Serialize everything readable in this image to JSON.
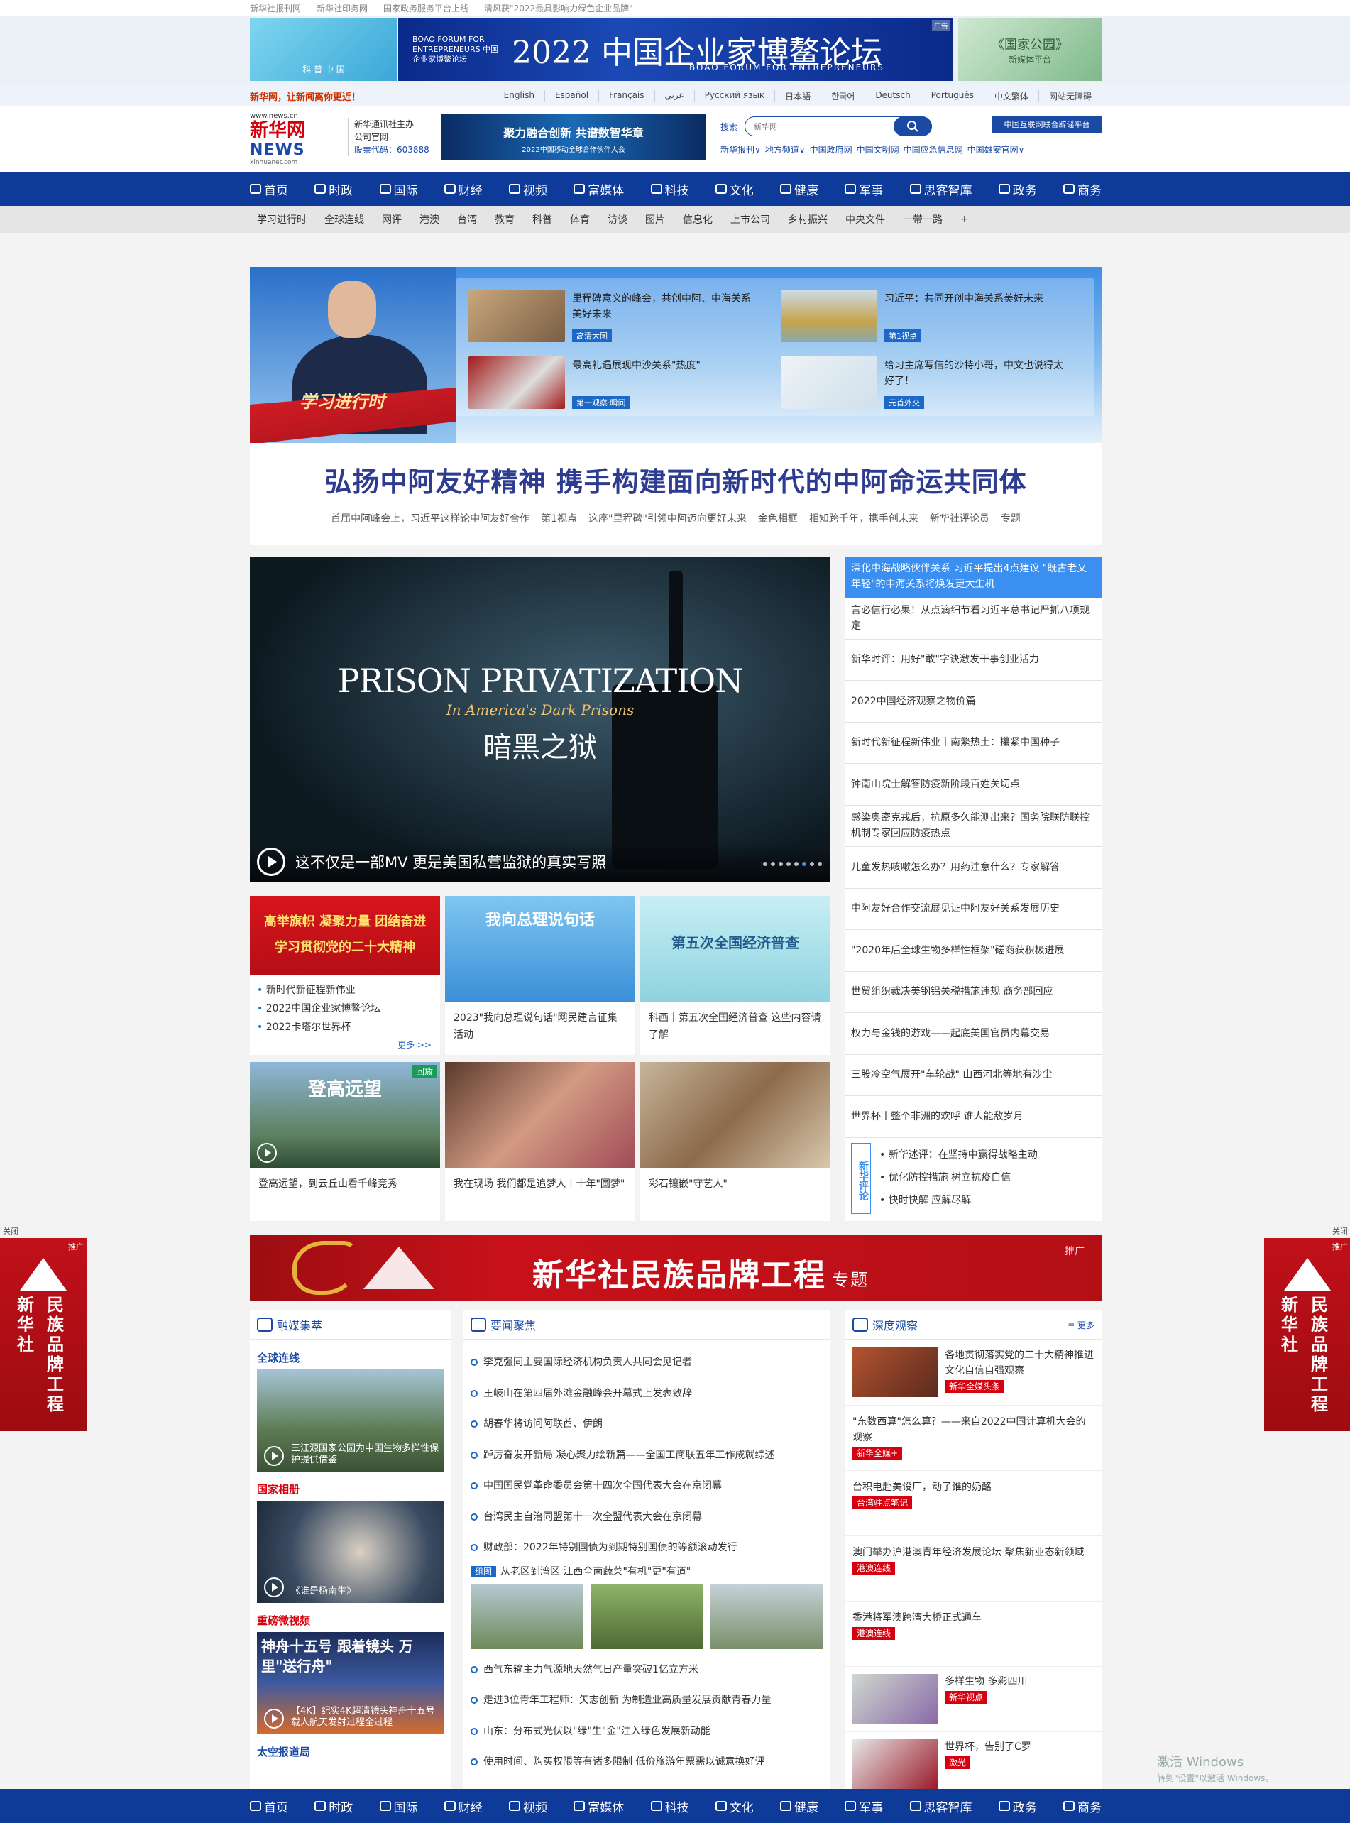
{
  "top_links": [
    "新华社报刊网",
    "新华社印务网",
    "国家政务服务平台上线",
    "清风获\"2022最具影响力绿色企业品牌\""
  ],
  "ads": {
    "ad1_text": "科 普 中 国",
    "ad2_small": "BOAO FORUM FOR ENTREPRENEURS 中国企业家博鳌论坛",
    "ad2_big": "2022 中国企业家博鳌论坛",
    "ad2_sub": "BOAO FORUM FOR ENTREPRENEURS",
    "ad2_tag": "广告",
    "ad3_title": "《国家公园》",
    "ad3_sub": "新媒体平台"
  },
  "lang_bar": {
    "slogan": "新华网，让新闻离你更近！",
    "languages": [
      "English",
      "Español",
      "Français",
      "عربي",
      "Русский язык",
      "日本語",
      "한국어",
      "Deutsch",
      "Português",
      "中文繁体",
      "网站无障碍"
    ]
  },
  "header": {
    "logo_url": "www.news.cn",
    "logo_cn": "新华网",
    "logo_en": "NEWS",
    "logo_site": "xinhuanet.com",
    "info_line1": "新华通讯社主办",
    "info_line2": "公司官网",
    "info_line3": "股票代码：603888",
    "banner_title": "聚力融合创新 共谱数智华章",
    "banner_sub": "2022中国移动全球合作伙伴大会",
    "search_label": "搜索",
    "search_placeholder": "新华网",
    "sublinks": [
      "新华报刊∨",
      "地方频道∨",
      "中国政府网",
      "中国文明网",
      "中国应急信息网",
      "中国雄安官网∨"
    ],
    "right_button": "中国互联网联合辟谣平台"
  },
  "nav": [
    "首页",
    "时政",
    "国际",
    "财经",
    "视频",
    "富媒体",
    "科技",
    "文化",
    "健康",
    "军事",
    "思客智库",
    "政务",
    "商务"
  ],
  "subnav": [
    "学习进行时",
    "全球连线",
    "网评",
    "港澳",
    "台湾",
    "教育",
    "科普",
    "体育",
    "访谈",
    "图片",
    "信息化",
    "上市公司",
    "乡村振兴",
    "中央文件",
    "一带一路",
    "+"
  ],
  "study": {
    "banner_text": "学习进行时",
    "items": [
      {
        "title": "里程碑意义的峰会，共创中阿、中海关系美好未来",
        "tag": "高清大图"
      },
      {
        "title": "习近平：共同开创中海关系美好未来",
        "tag": "第1视点"
      },
      {
        "title": "最高礼遇展现中沙关系\"热度\"",
        "tag": "第一观察·瞬间"
      },
      {
        "title": "给习主席写信的沙特小哥，中文也说得太好了！",
        "tag": "元首外交"
      }
    ]
  },
  "headline": {
    "title": "弘扬中阿友好精神 携手构建面向新时代的中阿命运共同体",
    "links": [
      "首届中阿峰会上，习近平这样论中阿友好合作",
      "第1视点",
      "这座\"里程碑\"引领中阿迈向更好未来",
      "金色相框",
      "相知跨千年，携手创未来",
      "新华社评论员",
      "专题"
    ]
  },
  "slider": {
    "en_title": "PRISON PRIVATIZATION",
    "en_sub": "In America's Dark Prisons",
    "zh_title": "暗黑之狱",
    "caption": "这不仅是一部MV 更是美国私营监狱的真实写照",
    "active_dot": 5,
    "dot_count": 8
  },
  "right_list": {
    "featured": "深化中海战略伙伴关系 习近平提出4点建议 \"既古老又年轻\"的中海关系将焕发更大生机",
    "rows": [
      "言必信行必果！从点滴细节看习近平总书记严抓八项规定",
      "新华时评：用好\"敢\"字诀激发干事创业活力",
      "2022中国经济观察之物价篇",
      "新时代新征程新伟业丨南繁热土：攥紧中国种子",
      "钟南山院士解答防疫新阶段百姓关切点",
      "感染奥密克戎后，抗原多久能测出来？国务院联防联控机制专家回应防疫热点",
      "儿童发热咳嗽怎么办？用药注意什么？专家解答",
      "中阿友好合作交流展见证中阿友好关系发展历史",
      "\"2020年后全球生物多样性框架\"磋商获积极进展",
      "世贸组织裁决美钢铝关税措施违规 商务部回应",
      "权力与金钱的游戏——起底美国官员内幕交易",
      "三股冷空气展开\"车轮战\" 山西河北等地有沙尘",
      "世界杯丨整个非洲的欢呼 谁人能敌岁月"
    ],
    "comment_label": "新华评论",
    "comments": [
      "新华述评：在坚持中赢得战略主动",
      "优化防控措施 树立抗疫自信",
      "快时快解 应解尽解"
    ]
  },
  "tiles": {
    "t1_banner1": "高举旗帜 凝聚力量 团结奋进",
    "t1_banner2": "学习贯彻党的二十大精神",
    "t1_items": [
      "新时代新征程新伟业",
      "2022中国企业家博鳌论坛",
      "2022卡塔尔世界杯"
    ],
    "t1_more": "更多 >>",
    "t2_img": "我向总理说句话",
    "t2_cap": "2023\"我向总理说句话\"网民建言征集活动",
    "t3_img": "第五次全国经济普查",
    "t3_cap": "科画丨第五次全国经济普查 这些内容请了解",
    "t4_img": "登高远望",
    "t4_badge": "回放",
    "t4_cap": "登高远望，到云丘山看千峰竞秀",
    "t5_cap": "我在现场 我们都是追梦人丨十年\"圆梦\"",
    "t6_cap": "彩石镶嵌\"守艺人\""
  },
  "brand_banner": {
    "title": "新华社民族品牌工程",
    "suffix": "专题",
    "tag": "推广"
  },
  "float_ad": {
    "close": "关闭",
    "tag": "推广",
    "text": [
      "民族品牌工程",
      "新华社"
    ]
  },
  "col1": {
    "title": "融媒集萃",
    "sec1": "全球连线",
    "img1_cap": "三江源国家公园为中国生物多样性保护提供借鉴",
    "sec2": "国家相册",
    "img2_cap": "《谁是杨南生》",
    "sec3": "重磅微视频",
    "img3_title": "神舟十五号 跟着镜头 万里\"送行舟\"",
    "img3_cap": "【4K】纪实4K超清镜头神舟十五号载人航天发射过程全过程",
    "sec4": "太空报道局"
  },
  "col2": {
    "title": "要闻聚焦",
    "items_top": [
      "李克强同主要国际经济机构负责人共同会见记者",
      "王岐山在第四届外滩金融峰会开幕式上发表致辞",
      "胡春华将访问阿联酋、伊朗",
      "踔厉奋发开新局 凝心聚力绘新篇——全国工商联五年工作成就综述",
      "中国国民党革命委员会第十四次全国代表大会在京闭幕",
      "台湾民主自治同盟第十一次全盟代表大会在京闭幕",
      "财政部：2022年特别国债为到期特别国债的等额滚动发行"
    ],
    "photo_tag": "组图",
    "photo_title": "从老区到湾区 江西全南蔬菜\"有机\"更\"有道\"",
    "items_bottom": [
      "西气东输主力气源地天然气日产量突破1亿立方米",
      "走进3位青年工程师：矢志创新 为制造业高质量发展贡献青春力量",
      "山东：分布式光伏以\"绿\"生\"金\"注入绿色发展新动能",
      "使用时间、购买权限等有诸多限制 低价旅游年票需以诚意换好评"
    ]
  },
  "col3": {
    "title": "深度观察",
    "more": "更多",
    "items": [
      {
        "title": "各地贯彻落实党的二十大精神推进文化自信自强观察",
        "tag": "新华全媒头条"
      },
      {
        "title": "\"东数西算\"怎么算？——来自2022中国计算机大会的观察",
        "tag": "新华全媒+"
      },
      {
        "title": "台积电赴美设厂，动了谁的奶酪",
        "tag": "台湾驻点笔记"
      },
      {
        "title": "澳门举办沪港澳青年经济发展论坛 聚焦新业态新领域",
        "tag": "港澳连线"
      },
      {
        "title": "香港将军澳跨湾大桥正式通车",
        "tag": "港澳连线"
      },
      {
        "title": "多样生物 多彩四川",
        "tag": "新华视点"
      },
      {
        "title": "世界杯，告别了C罗",
        "tag": "激光"
      }
    ]
  },
  "watermark": {
    "line1": "激活 Windows",
    "line2": "转到\"设置\"以激活 Windows。"
  },
  "colors": {
    "nav_blue": "#0e3a9a",
    "accent_blue": "#3b8ff0",
    "brand_red": "#d7000f",
    "headline_blue": "#2d3c91"
  }
}
